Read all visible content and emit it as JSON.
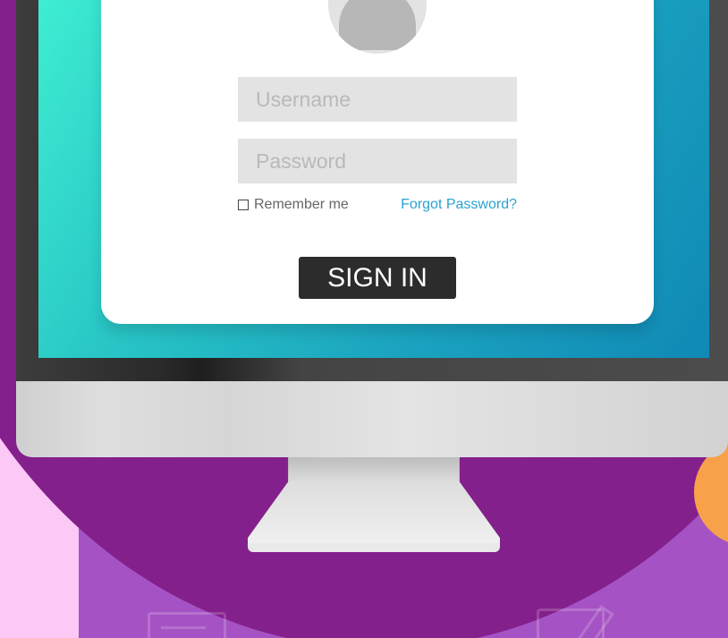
{
  "login": {
    "username_placeholder": "Username",
    "password_placeholder": "Password",
    "remember_label": "Remember me",
    "forgot_label": "Forgot Password?",
    "signin_label": "SIGN IN"
  },
  "colors": {
    "background_circle": "#83208b",
    "background_mauve": "#a553c4",
    "background_pink": "#fcc8f6",
    "accent_orange": "#f7a14a",
    "screen_gradient_start": "#3fefd2",
    "screen_gradient_end": "#1089b5",
    "field_background": "#e3e3e3",
    "link": "#2aa2cf",
    "button": "#2c2c2c"
  },
  "icons": {
    "avatar": "user-avatar-icon",
    "checkbox": "checkbox-icon"
  }
}
